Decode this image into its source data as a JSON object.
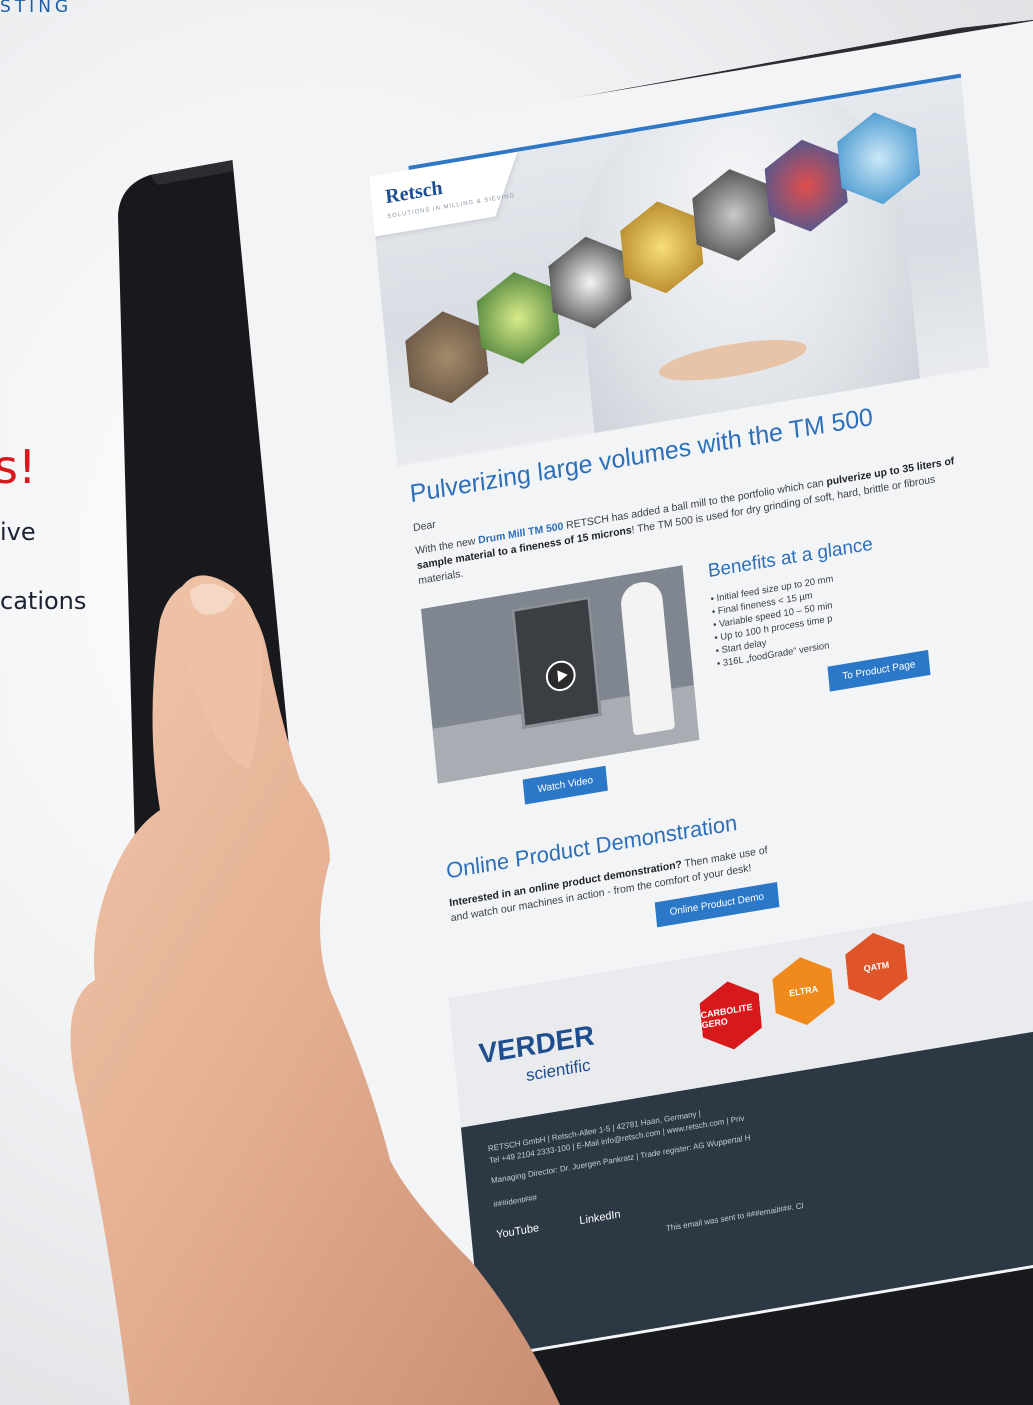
{
  "page": {
    "top_label": "STING",
    "headline_fragment": "s!",
    "line1_fragment": "ive",
    "line2_fragment": "cations"
  },
  "email": {
    "logo": "Retsch",
    "logo_tagline": "SOLUTIONS IN MILLING & SIEVING",
    "title": "Pulverizing large volumes with the TM 500",
    "greeting": "Dear",
    "intro_pre": "With the new",
    "intro_link": "Drum Mill TM 500",
    "intro_mid": "RETSCH has added a ball mill to the portfolio which can",
    "intro_bold": "pulverize up to 35 liters of sample material to a fineness of 15 microns",
    "intro_post": "! The TM 500 is used for dry grinding of soft, hard, brittle or fibrous materials.",
    "benefits_title": "Benefits at a glance",
    "benefits": [
      "Initial feed size up to 20 mm",
      "Final fineness < 15 µm",
      "Variable speed 10 – 50 min",
      "Up to 100 h process time p",
      "Start delay",
      "316L „foodGrade“ version"
    ],
    "watch_video": "Watch Video",
    "product_page": "To Product Page",
    "demo_title": "Online Product Demonstration",
    "demo_bold": "Interested in an online product demonstration?",
    "demo_text_1": " Then make use of",
    "demo_text_2": "and watch our machines in action - from the comfort of your desk!",
    "demo_button": "Online Product Demo",
    "brand_main": "VERDER",
    "brand_sub": "scientific",
    "brand_hexes": [
      "CARBOLITE GERO",
      "ELTRA",
      "QATM"
    ],
    "footer_line1": "RETSCH GmbH | Retsch-Allee 1-5 | 42781 Haan, Germany |",
    "footer_line2": "Tel +49 2104 2333-100 | E-Mail info@retsch.com | www.retsch.com | Priv",
    "footer_line3": "Managing Director: Dr. Juergen Pankratz | Trade register: AG Wuppertal H",
    "footer_ident": "###ident###",
    "social_youtube": "YouTube",
    "social_linkedin": "LinkedIn",
    "footer_sent": "This email was sent to ###email###. Cl"
  },
  "colors": {
    "accent_blue": "#2b78c8",
    "headline_red": "#d7191c",
    "footer_bg": "#2c3945"
  }
}
